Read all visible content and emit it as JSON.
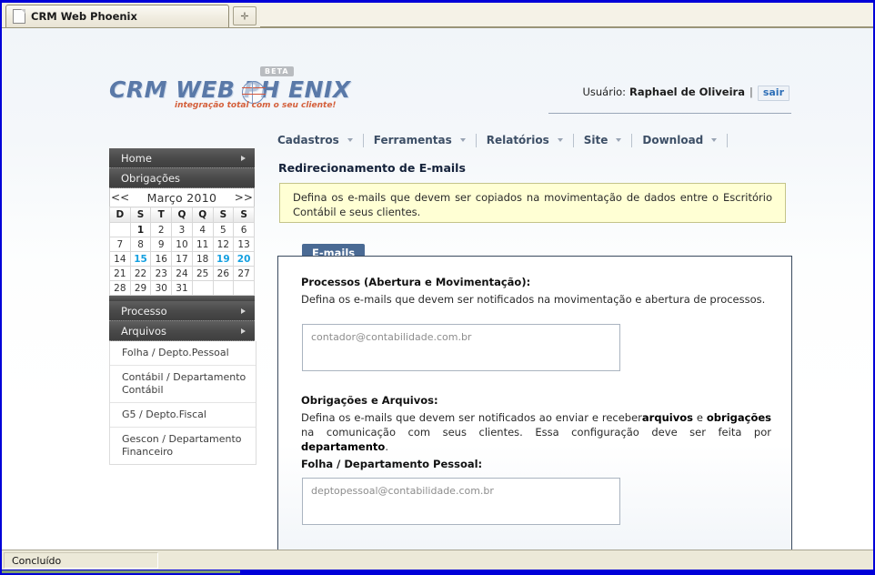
{
  "browser": {
    "tab_title": "CRM Web Phoenix",
    "tab_icon": "document-icon",
    "new_tab_glyph": "✛",
    "status_text": "Concluído"
  },
  "header": {
    "logo_text": "CRM WEB PH   ENIX",
    "logo_tagline": "integração total com o seu cliente!",
    "beta_badge": "BETA",
    "user_label": "Usuário:",
    "user_name": "Raphael de Oliveira",
    "separator": "|",
    "logout_label": "sair",
    "accent_color": "#5a79a8",
    "tagline_color": "#d4603c"
  },
  "menu": {
    "items": [
      {
        "label": "Cadastros"
      },
      {
        "label": "Ferramentas"
      },
      {
        "label": "Relatórios"
      },
      {
        "label": "Site"
      },
      {
        "label": "Download"
      }
    ]
  },
  "sidebar": {
    "nav_top": [
      {
        "label": "Home",
        "has_arrow": true
      },
      {
        "label": "Obrigações",
        "has_arrow": false
      }
    ],
    "nav_bottom": [
      {
        "label": "Processo",
        "has_arrow": true
      },
      {
        "label": "Arquivos",
        "has_arrow": true
      }
    ],
    "departments": [
      {
        "label": "Folha / Depto.Pessoal"
      },
      {
        "label": "Contábil / Departamento Contábil"
      },
      {
        "label": "G5 / Depto.Fiscal"
      },
      {
        "label": "Gescon / Departamento Financeiro"
      }
    ]
  },
  "calendar": {
    "prev_label": "<<",
    "next_label": ">>",
    "title": "Março 2010",
    "dow": [
      "D",
      "S",
      "T",
      "Q",
      "Q",
      "S",
      "S"
    ],
    "weeks": [
      [
        {
          "d": ""
        },
        {
          "d": "1",
          "style": "bold"
        },
        {
          "d": "2"
        },
        {
          "d": "3"
        },
        {
          "d": "4"
        },
        {
          "d": "5"
        },
        {
          "d": "6"
        }
      ],
      [
        {
          "d": "7"
        },
        {
          "d": "8"
        },
        {
          "d": "9"
        },
        {
          "d": "10"
        },
        {
          "d": "11"
        },
        {
          "d": "12"
        },
        {
          "d": "13"
        }
      ],
      [
        {
          "d": "14"
        },
        {
          "d": "15",
          "style": "link"
        },
        {
          "d": "16"
        },
        {
          "d": "17"
        },
        {
          "d": "18"
        },
        {
          "d": "19",
          "style": "link"
        },
        {
          "d": "20",
          "style": "link"
        }
      ],
      [
        {
          "d": "21"
        },
        {
          "d": "22"
        },
        {
          "d": "23"
        },
        {
          "d": "24"
        },
        {
          "d": "25"
        },
        {
          "d": "26"
        },
        {
          "d": "27"
        }
      ],
      [
        {
          "d": "28"
        },
        {
          "d": "29"
        },
        {
          "d": "30"
        },
        {
          "d": "31"
        },
        {
          "d": ""
        },
        {
          "d": ""
        },
        {
          "d": ""
        }
      ]
    ],
    "link_color": "#14a0e0"
  },
  "main": {
    "page_title": "Redirecionamento de E-mails",
    "info_box": "Defina os e-mails que devem ser copiados na movimentação de dados entre o Escritório Contábil e seus clientes.",
    "info_box_bg": "#ffffd4",
    "tab_label": "E-mails",
    "tab_color": "#4a6a94",
    "section1": {
      "title": "Processos (Abertura e Movimentação):",
      "desc": "Defina os e-mails que devem ser notificados na movimentação e abertura de processos.",
      "field_value": "contador@contabilidade.com.br"
    },
    "section2": {
      "title": "Obrigações e Arquivos:",
      "desc_part1": "Defina os e-mails que devem ser notificados ao enviar e receber",
      "desc_bold1": "arquivos",
      "desc_part2": " e ",
      "desc_bold2": "obrigações",
      "desc_part3": " na comunicação com seus clientes. Essa configuração deve ser feita por ",
      "desc_bold3": "departamento",
      "desc_part4": ".",
      "subtitle": "Folha / Departamento Pessoal:",
      "field_value": "deptopessoal@contabilidade.com.br"
    }
  }
}
